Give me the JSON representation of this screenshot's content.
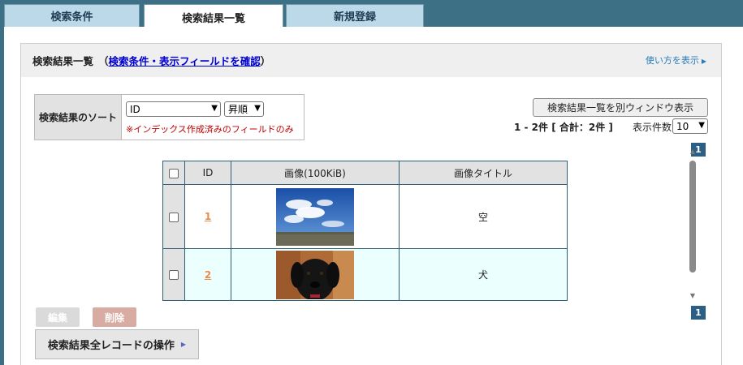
{
  "tabs": {
    "search": "検索条件",
    "results": "検索結果一覧",
    "register": "新規登録"
  },
  "header": {
    "title": "検索結果一覧",
    "link_open": "（",
    "link": "検索条件・表示フィールドを確認",
    "link_close": "）",
    "howto": "使い方を表示"
  },
  "sort": {
    "label": "検索結果のソート",
    "field": "ID",
    "order": "昇順",
    "note": "※インデックス作成済みのフィールドのみ"
  },
  "actions": {
    "open_window": "検索結果一覧を別ウィンドウ表示",
    "count": "1 - 2件 [ 合計：2件 ]",
    "perpage_label": "表示件数",
    "perpage_value": "10",
    "page": "1"
  },
  "table": {
    "headers": [
      "ID",
      "画像(100KiB)",
      "画像タイトル"
    ],
    "rows": [
      {
        "id": "1",
        "image": "sky",
        "title": "空"
      },
      {
        "id": "2",
        "image": "dog",
        "title": "犬"
      }
    ]
  },
  "bottom": {
    "edit": "編集",
    "delete": "削除",
    "all_records": "検索結果全レコードの操作"
  },
  "colors": {
    "frame": "#3d6f85",
    "tab": "#bcd9ea",
    "pager": "#2b5f86",
    "delete": "#d8aca2",
    "edit": "#dadada",
    "alt_row": "#eafffe",
    "id_link": "#f08a48"
  }
}
